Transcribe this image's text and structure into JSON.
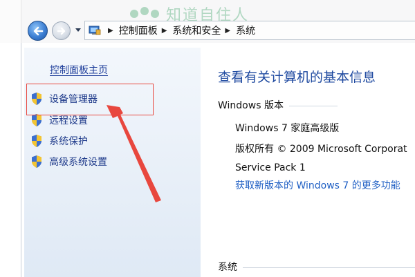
{
  "watermark": {
    "text": "知道自住人"
  },
  "nav": {
    "breadcrumbs": [
      "控制面板",
      "系统和安全",
      "系统"
    ]
  },
  "sidebar": {
    "home_link": "控制面板主页",
    "tasks": [
      {
        "label": "设备管理器",
        "icon": "uac-shield-icon"
      },
      {
        "label": "远程设置",
        "icon": "uac-shield-icon"
      },
      {
        "label": "系统保护",
        "icon": "uac-shield-icon"
      },
      {
        "label": "高级系统设置",
        "icon": "uac-shield-icon"
      }
    ]
  },
  "main": {
    "heading": "查看有关计算机的基本信息",
    "windows_edition": {
      "title": "Windows 版本",
      "edition": "Windows 7 家庭高级版",
      "copyright": "版权所有 © 2009 Microsoft Corporat",
      "service_pack": "Service Pack 1",
      "upgrade_link": "获取新版本的 Windows 7 的更多功能"
    },
    "system_section": {
      "title": "系统"
    }
  },
  "colors": {
    "annotation_red": "#e8473e",
    "link_blue": "#1f5fc4",
    "heading_blue": "#1f4aa0"
  }
}
